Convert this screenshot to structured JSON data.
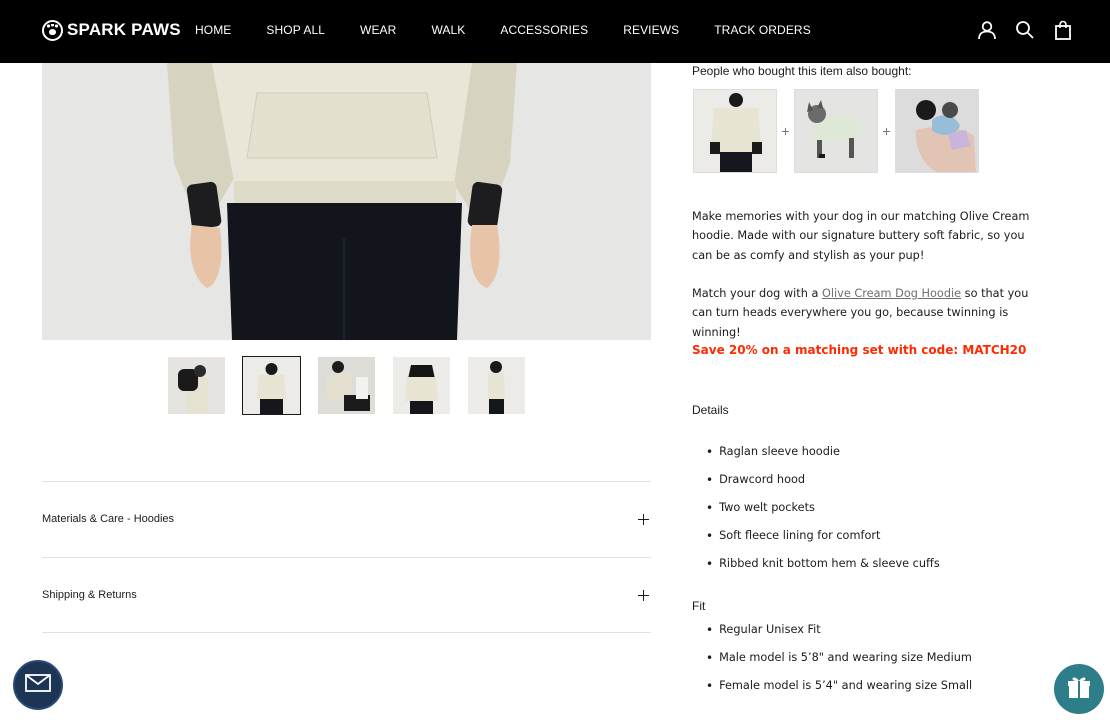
{
  "header": {
    "brand": "SPARK PAWS",
    "nav": [
      "HOME",
      "SHOP ALL",
      "WEAR",
      "WALK",
      "ACCESSORIES",
      "REVIEWS",
      "TRACK ORDERS"
    ],
    "icons": [
      "account-icon",
      "search-icon",
      "cart-icon"
    ]
  },
  "gallery": {
    "thumbnails": [
      "thumb-1",
      "thumb-2",
      "thumb-3",
      "thumb-4",
      "thumb-5"
    ],
    "active_index": 1
  },
  "accordions": [
    {
      "title": "Materials & Care - Hoodies"
    },
    {
      "title": "Shipping & Returns"
    }
  ],
  "product": {
    "also_bought": "People who bought this item also bought:",
    "description": "Make memories with your dog in our matching Olive Cream hoodie. Made with our signature buttery soft fabric, so you can be as comfy and stylish as your pup!",
    "match_prefix": "Match your dog with a ",
    "match_link": "Olive Cream Dog Hoodie",
    "match_suffix": " so that you can turn heads everywhere you go, because twinning is winning!",
    "promo": "Save 20% on a matching set with code: MATCH20",
    "details_label": "Details",
    "details": [
      "Raglan sleeve hoodie",
      "Drawcord hood",
      "Two welt pockets",
      "Soft fleece lining for comfort",
      "Ribbed knit bottom hem & sleeve cuffs"
    ],
    "fit_label": "Fit",
    "fit": [
      "Regular Unisex Fit",
      "Male model  is 5’8\" and wearing size Medium",
      "Female model is 5’4\" and wearing size Small"
    ]
  },
  "colors": {
    "header_bg": "#000000",
    "promo": "#ff2a00",
    "mail_widget": "#1c3554",
    "gift_widget": "#2e7e8a"
  }
}
